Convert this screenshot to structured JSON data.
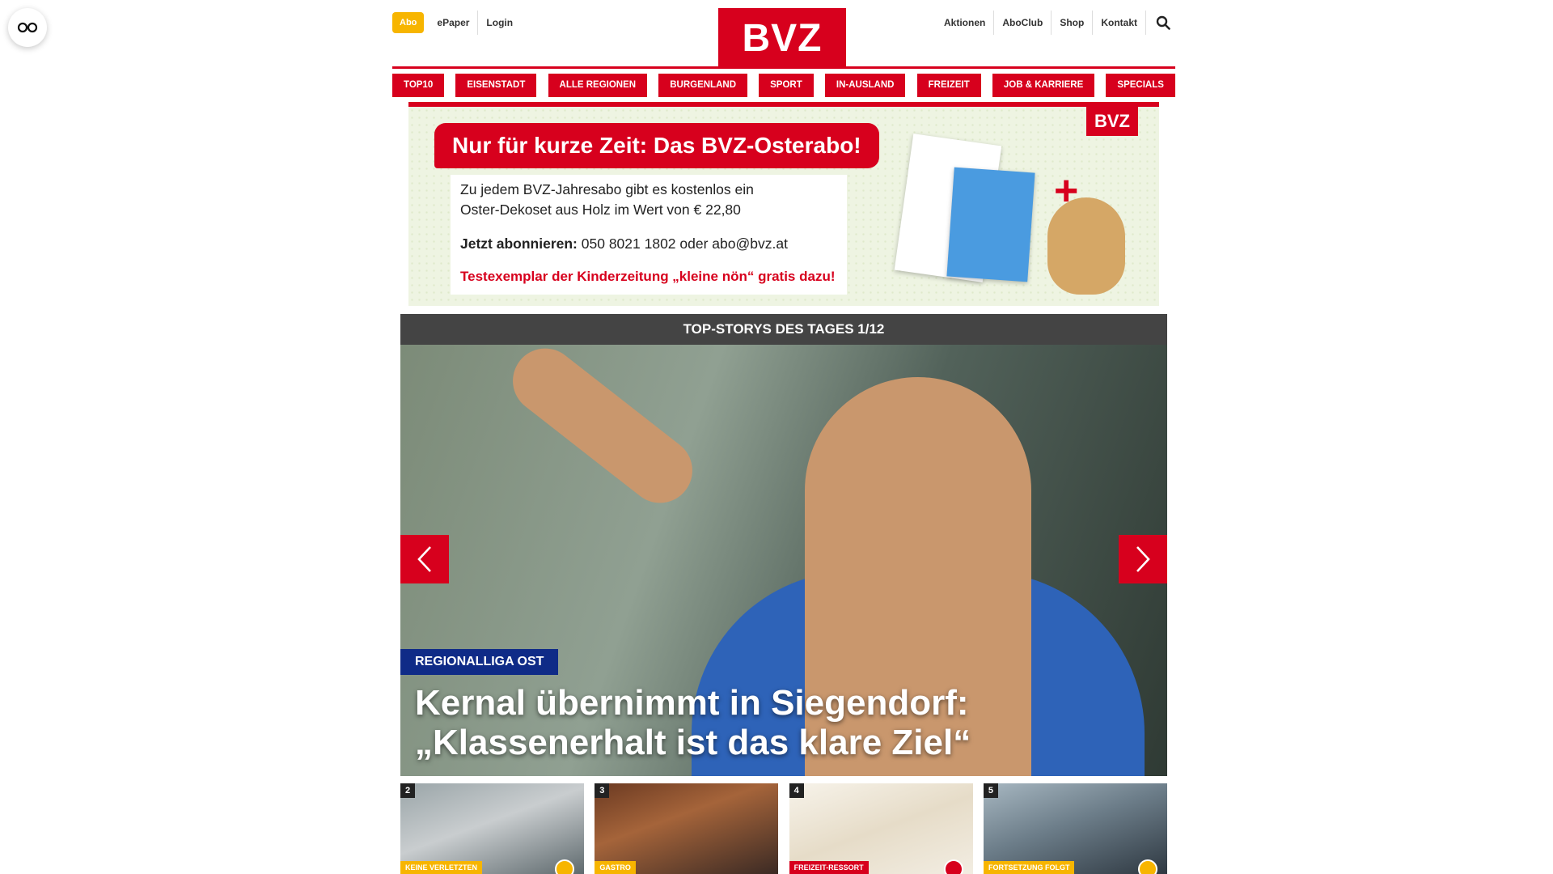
{
  "header": {
    "abo": "Abo",
    "epaper": "ePaper",
    "login": "Login",
    "logo": "BVZ",
    "right_links": [
      "Aktionen",
      "AboClub",
      "Shop",
      "Kontakt"
    ]
  },
  "nav": [
    "TOP10",
    "EISENSTADT",
    "ALLE REGIONEN",
    "BURGENLAND",
    "SPORT",
    "IN-AUSLAND",
    "FREIZEIT",
    "JOB & KARRIERE",
    "SPECIALS"
  ],
  "ad": {
    "headline": "Nur für kurze Zeit: Das BVZ-Osterabo!",
    "line1": "Zu jedem BVZ-Jahresabo gibt es kostenlos ein",
    "line2": "Oster-Dekoset aus Holz im Wert von € 22,80",
    "cta_label": "Jetzt abonnieren:",
    "cta_text": " 050 8021 1802 oder abo@bvz.at",
    "promo": "Testexemplar der Kinderzeitung „kleine nön“ gratis dazu!",
    "logo": "BVZ",
    "plus": "+"
  },
  "carousel": {
    "title": "TOP-STORYS DES TAGES 1/12",
    "kicker": "REGIONALLIGA OST",
    "headline_1": "Kernal übernimmt in Siegendorf:",
    "headline_2": "„Klassenerhalt ist das klare Ziel“"
  },
  "teasers": [
    {
      "num": "2",
      "tag": "KEINE VERLETZTEN",
      "badge": "yellow"
    },
    {
      "num": "3",
      "tag": "GASTRO",
      "badge": "none"
    },
    {
      "num": "4",
      "tag": "FREIZEIT-RESSORT",
      "badge": "red"
    },
    {
      "num": "5",
      "tag": "FORTSETZUNG FOLGT",
      "badge": "yellow"
    }
  ],
  "colors": {
    "brand_red": "#d7001d",
    "abo_yellow": "#f7b500",
    "kicker_blue": "#0f2b87"
  }
}
